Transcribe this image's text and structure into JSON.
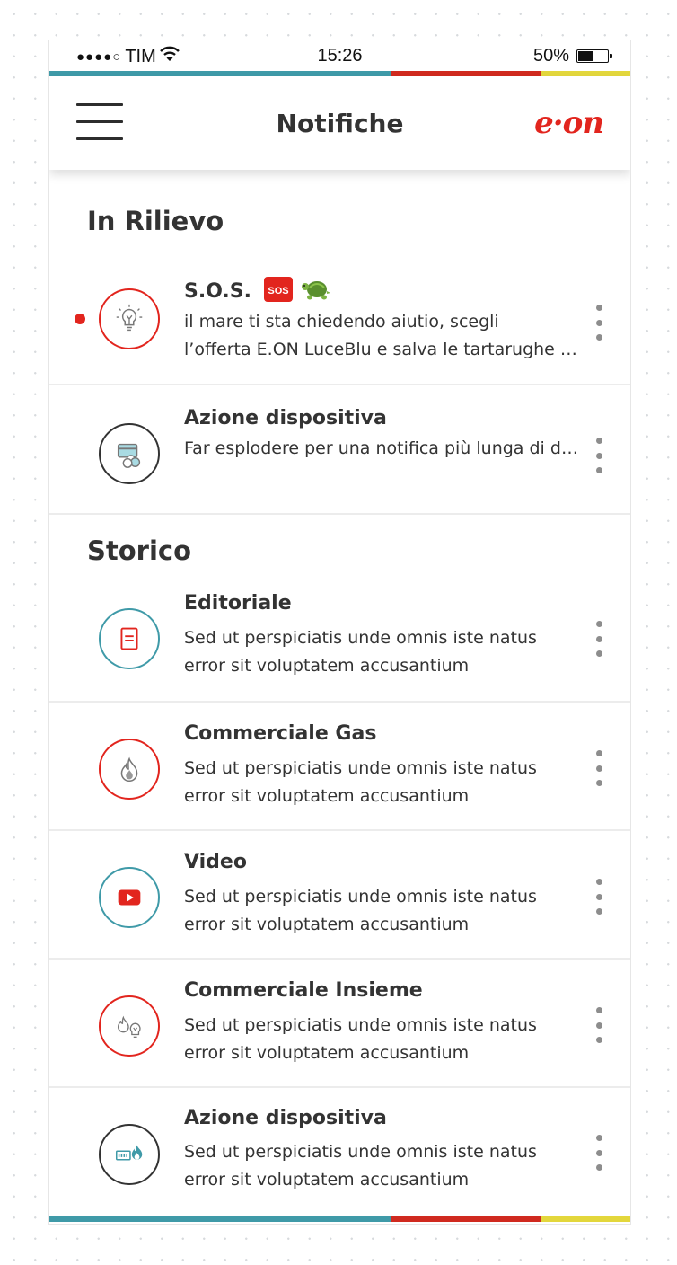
{
  "status_bar": {
    "signal": "●●●●○",
    "carrier": "TIM",
    "time": "15:26",
    "battery_percent": "50%",
    "battery_level": 0.5
  },
  "nav": {
    "title": "Notifiche",
    "logo_text": "e·on",
    "menu_icon": "hamburger-icon"
  },
  "colors": {
    "brand_red": "#e2251e",
    "teal": "#3f9aa8",
    "dark_red": "#d02a1f",
    "yellow": "#e3d73c",
    "text": "#333333"
  },
  "sections": {
    "highlight_title": "In Rilievo",
    "history_title": "Storico"
  },
  "highlight": [
    {
      "title": "S.O.S.",
      "badge": "SOS",
      "emoji": "turtle",
      "body": [
        "il mare ti sta chiedendo aiutio, scegli",
        "l’offerta E.ON LuceBlu e salva le tartarughe marine"
      ],
      "icon": "lightbulb-icon",
      "unread": true
    },
    {
      "title": "Azione dispositiva",
      "body": [
        "Far esplodere per una notifica  più lunga di due righe"
      ],
      "icon": "card-coins-icon",
      "unread": false
    }
  ],
  "history": [
    {
      "title": "Editoriale",
      "body": [
        "Sed ut perspiciatis unde omnis iste natus",
        "error sit voluptatem accusantium"
      ],
      "icon": "document-icon"
    },
    {
      "title": "Commerciale Gas",
      "body": [
        "Sed ut perspiciatis unde omnis iste natus",
        "error sit voluptatem accusantium"
      ],
      "icon": "flame-icon"
    },
    {
      "title": "Video",
      "body": [
        "Sed ut perspiciatis unde omnis iste natus",
        "error sit voluptatem accusantium"
      ],
      "icon": "play-icon"
    },
    {
      "title": "Commerciale Insieme",
      "body": [
        "Sed ut perspiciatis unde omnis iste natus",
        "error sit voluptatem accusantium"
      ],
      "icon": "flame-bulb-icon"
    },
    {
      "title": "Azione dispositiva",
      "body": [
        "Sed ut perspiciatis unde omnis iste natus",
        "error sit voluptatem accusantium"
      ],
      "icon": "meter-flame-icon"
    }
  ]
}
